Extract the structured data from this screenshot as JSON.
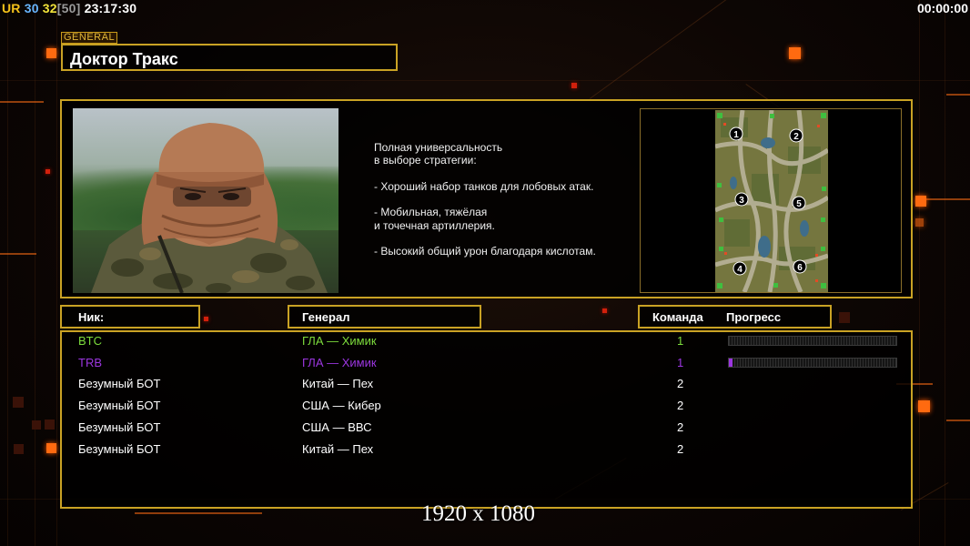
{
  "hud": {
    "ur_label": "UR",
    "stat_a": "30",
    "stat_b": "32",
    "stat_c": "[50]",
    "clock": "23:17:30",
    "timer": "00:00:00"
  },
  "general": {
    "tag": "GENERAL",
    "name": "Доктор Тракс",
    "description": [
      "Полная универсальность",
      "в выборе стратегии:",
      "",
      "- Хороший набор танков для лобовых атак.",
      "",
      "- Мобильная, тяжёлая",
      "и точечная артиллерия.",
      "",
      "- Высокий общий урон благодаря кислотам."
    ]
  },
  "minimap": {
    "start_positions": [
      "1",
      "2",
      "3",
      "5",
      "4",
      "6"
    ]
  },
  "columns": {
    "nick": "Ник:",
    "general": "Генерал",
    "team": "Команда",
    "progress": "Прогресс"
  },
  "players": [
    {
      "nick": "BTC",
      "general": "ГЛА — Химик",
      "team": "1",
      "color": "#7ddc3c",
      "progress": 0.0,
      "show_progress": true
    },
    {
      "nick": "TRB",
      "general": "ГЛА — Химик",
      "team": "1",
      "color": "#9c36e0",
      "progress": 0.02,
      "show_progress": true
    },
    {
      "nick": "Безумный БОТ",
      "general": "Китай — Пех",
      "team": "2",
      "color": "#ffffff",
      "show_progress": false
    },
    {
      "nick": "Безумный БОТ",
      "general": "США — Кибер",
      "team": "2",
      "color": "#ffffff",
      "show_progress": false
    },
    {
      "nick": "Безумный БОТ",
      "general": "США — ВВС",
      "team": "2",
      "color": "#ffffff",
      "show_progress": false
    },
    {
      "nick": "Безумный БОТ",
      "general": "Китай — Пех",
      "team": "2",
      "color": "#ffffff",
      "show_progress": false
    }
  ],
  "resolution_caption": "1920 x 1080",
  "colors": {
    "frame_gold": "#c9a224",
    "accent_orange": "#ff6a10",
    "team1_green": "#7ddc3c",
    "team1_purple": "#9c36e0"
  }
}
